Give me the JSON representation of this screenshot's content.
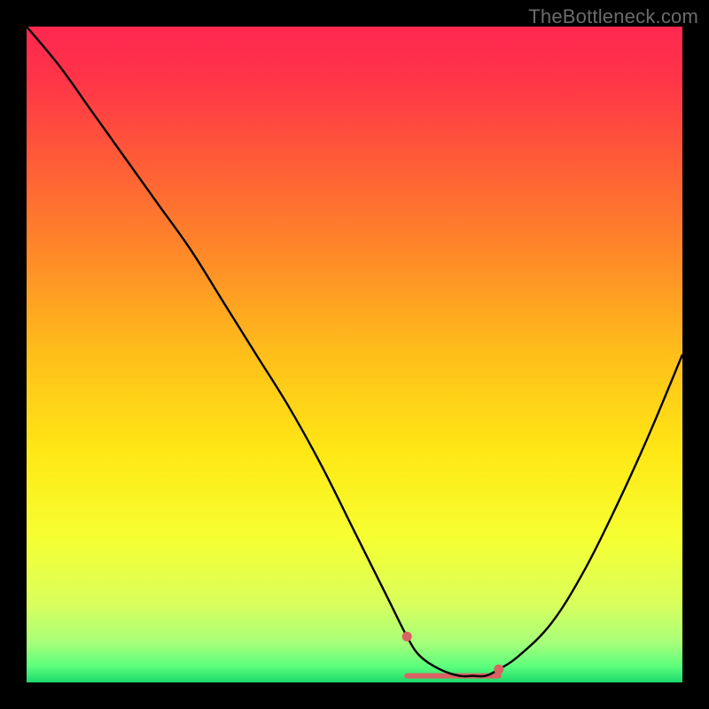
{
  "watermark": "TheBottleneck.com",
  "chart_data": {
    "type": "line",
    "title": "",
    "xlabel": "",
    "ylabel": "",
    "xlim": [
      0,
      100
    ],
    "ylim": [
      0,
      100
    ],
    "x": [
      0,
      5,
      10,
      15,
      20,
      25,
      30,
      35,
      40,
      45,
      50,
      55,
      58,
      60,
      63,
      66,
      68,
      70,
      72,
      75,
      80,
      85,
      90,
      95,
      100
    ],
    "values": [
      100,
      94,
      87,
      80,
      73,
      66,
      58,
      50,
      42,
      33,
      23,
      13,
      7,
      4,
      2,
      1,
      1,
      1,
      2,
      4,
      9,
      17,
      27,
      38,
      50
    ],
    "optimal_band": {
      "x_start": 58,
      "x_end": 72,
      "markers_x": [
        58,
        72
      ],
      "markers_y": [
        7,
        2
      ]
    },
    "background_gradient": {
      "stops": [
        {
          "offset": 0.0,
          "color": "#ff2850"
        },
        {
          "offset": 0.08,
          "color": "#ff3448"
        },
        {
          "offset": 0.2,
          "color": "#ff5a38"
        },
        {
          "offset": 0.35,
          "color": "#ff8a28"
        },
        {
          "offset": 0.5,
          "color": "#ffbf1a"
        },
        {
          "offset": 0.65,
          "color": "#ffe815"
        },
        {
          "offset": 0.78,
          "color": "#f6ff32"
        },
        {
          "offset": 0.88,
          "color": "#d9ff5c"
        },
        {
          "offset": 0.94,
          "color": "#a6ff7a"
        },
        {
          "offset": 0.975,
          "color": "#5dff7d"
        },
        {
          "offset": 1.0,
          "color": "#1bd96a"
        }
      ]
    },
    "colors": {
      "curve": "#000000",
      "marker": "#d96363"
    }
  }
}
